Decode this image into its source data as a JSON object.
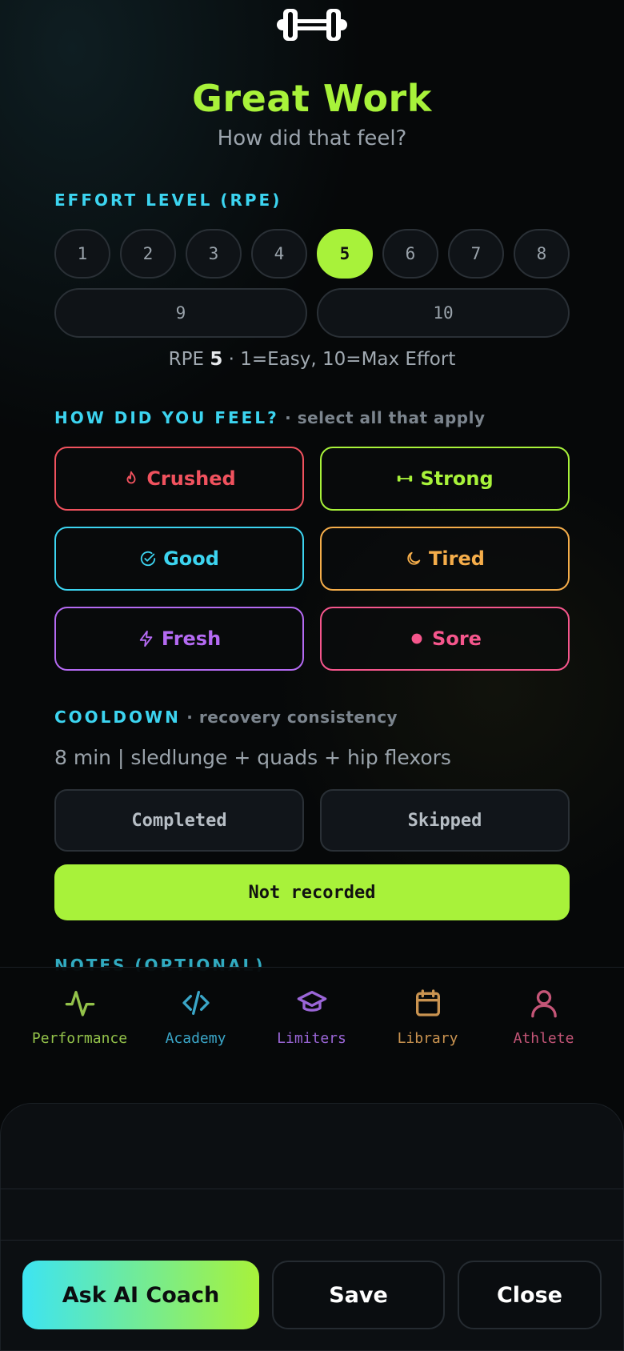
{
  "header": {
    "icon": "dumbbell-icon",
    "title": "Great Work",
    "subtitle": "How did that feel?"
  },
  "effort": {
    "label": "EFFORT LEVEL (RPE)",
    "levels": [
      "1",
      "2",
      "3",
      "4",
      "5",
      "6",
      "7",
      "8",
      "9",
      "10"
    ],
    "selected": "5",
    "caption_prefix": "RPE ",
    "caption_value": "5",
    "caption_suffix": " · 1=Easy, 10=Max Effort"
  },
  "feel": {
    "label": "HOW DID YOU FEEL?",
    "hint": " · select all that apply",
    "options": [
      {
        "label": "Crushed",
        "icon": "flame-icon",
        "color": "#f0525e"
      },
      {
        "label": "Strong",
        "icon": "dumbbell-icon",
        "color": "#a8f23a"
      },
      {
        "label": "Good",
        "icon": "check-circle-icon",
        "color": "#3cd4f0"
      },
      {
        "label": "Tired",
        "icon": "moon-icon",
        "color": "#f5ad4a"
      },
      {
        "label": "Fresh",
        "icon": "bolt-icon",
        "color": "#b46af2"
      },
      {
        "label": "Sore",
        "icon": "dot-icon",
        "color": "#f5568c"
      }
    ]
  },
  "cooldown": {
    "label": "COOLDOWN",
    "hint": " · recovery consistency",
    "description": "8 min | sledlunge + quads + hip flexors",
    "completed_label": "Completed",
    "skipped_label": "Skipped",
    "not_recorded_label": "Not recorded"
  },
  "notes": {
    "label": "NOTES (OPTIONAL)"
  },
  "nav": {
    "items": [
      {
        "label": "Performance",
        "icon": "activity-icon",
        "color": "#93c24a"
      },
      {
        "label": "Academy",
        "icon": "code-icon",
        "color": "#3aa6c8"
      },
      {
        "label": "Limiters",
        "icon": "graduation-cap-icon",
        "color": "#9b66d8"
      },
      {
        "label": "Library",
        "icon": "calendar-icon",
        "color": "#c99350"
      },
      {
        "label": "Athlete",
        "icon": "user-icon",
        "color": "#c45577"
      }
    ]
  },
  "actions": {
    "coach_label": "Ask AI Coach",
    "save_label": "Save",
    "close_label": "Close"
  }
}
